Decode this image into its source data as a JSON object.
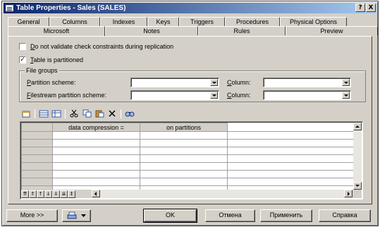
{
  "window": {
    "title": "Table Properties - Sales (SALES)",
    "controls": {
      "help": "?",
      "close": "X"
    }
  },
  "tabs": {
    "back_row": [
      "General",
      "Columns",
      "Indexes",
      "Keys",
      "Triggers",
      "Procedures",
      "Physical Options"
    ],
    "front_row": [
      "Microsoft",
      "Notes",
      "Rules",
      "Preview"
    ],
    "active": "Microsoft"
  },
  "options": {
    "no_validate_label": "Do not validate check constraints during replication",
    "no_validate_checked": false,
    "partitioned_label": "Table is partitioned",
    "partitioned_checked": true
  },
  "file_groups": {
    "group_label": "File groups",
    "partition_scheme_label": "Partition scheme:",
    "partition_scheme_value": "",
    "column_label": "Column:",
    "column_value": "",
    "filestream_scheme_label": "Filestream partition scheme:",
    "filestream_scheme_value": "",
    "column2_label": "Column:",
    "column2_value": ""
  },
  "toolbar_icons": [
    "properties-icon",
    "insert-row-icon",
    "add-row-icon",
    "cut-icon",
    "copy-icon",
    "paste-icon",
    "delete-icon",
    "find-icon"
  ],
  "grid": {
    "columns": [
      "",
      "data compression =",
      "on partitions",
      ""
    ],
    "empty_rows": 8
  },
  "buttons": {
    "more": "More >>",
    "ok": "OK",
    "cancel": "Отмена",
    "apply": "Применить",
    "help": "Справка"
  }
}
